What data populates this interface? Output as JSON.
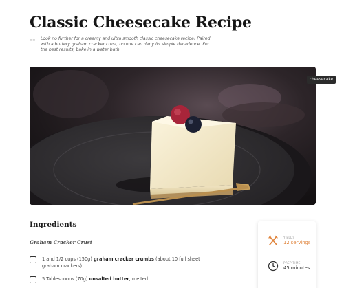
{
  "recipe": {
    "title": "Classic Cheesecake Recipe",
    "intro_marker": "≡≡",
    "intro": "Look no further for a creamy and ultra smooth classic cheesecake recipe! Paired with a buttery graham cracker crust, no one can deny its simple decadence. For the best results, bake in a water bath.",
    "image_tag": "cheesecake"
  },
  "ingredients": {
    "heading": "Ingredients",
    "subheading": "Graham Cracker Crust",
    "items": [
      {
        "pre": "1 and 1/2 cups (150g) ",
        "strong": "graham cracker crumbs",
        "post": " (about 10 full sheet graham crackers)"
      },
      {
        "pre": "5 Tablespoons (70g) ",
        "strong": "unsalted butter",
        "post": ", melted"
      }
    ]
  },
  "details": {
    "yield": {
      "label": "YIELDS",
      "value": "12 servings",
      "icon": "utensils-icon",
      "color": "#e0843c"
    },
    "prep": {
      "label": "PREP TIME",
      "value": "45 minutes",
      "icon": "clock-icon",
      "color": "#333333"
    }
  }
}
